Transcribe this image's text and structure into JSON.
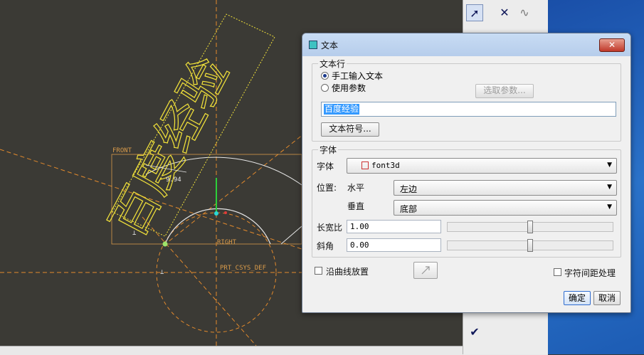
{
  "canvas": {
    "sketch_text": "百度经验",
    "dim_value": "9.94",
    "labels": {
      "front": "FRONT",
      "right": "RIGHT",
      "csys": "PRT_CSYS_DEF"
    }
  },
  "dialog": {
    "title": "文本",
    "close_label": "✕",
    "text_line": {
      "group_title": "文本行",
      "manual_label": "手工输入文本",
      "param_label": "使用参数",
      "select_param_button": "选取参数...",
      "text_value": "百度经验",
      "symbol_button": "文本符号..."
    },
    "font": {
      "group_title": "字体",
      "font_label": "字体",
      "font_value": "font3d",
      "position_label": "位置:",
      "horizontal_label": "水平",
      "horizontal_value": "左边",
      "vertical_label": "垂直",
      "vertical_value": "底部",
      "aspect_label": "长宽比",
      "aspect_value": "1.00",
      "aspect_slider_fraction": 0.5,
      "slant_label": "斜角",
      "slant_value": "0.00",
      "slant_slider_fraction": 0.5
    },
    "along_curve_label": "沿曲线放置",
    "char_spacing_label": "字符间距处理",
    "ok_button": "确定",
    "cancel_button": "取消"
  },
  "colors": {
    "canvas": "#3b3a35",
    "sketch": "#f2e23a",
    "dash": "#e38a2c",
    "selection": "#3399ff"
  },
  "toolbar_icons": [
    "arrow-select-icon",
    "cross-icon",
    "curve-icon",
    "checkmark-icon"
  ]
}
